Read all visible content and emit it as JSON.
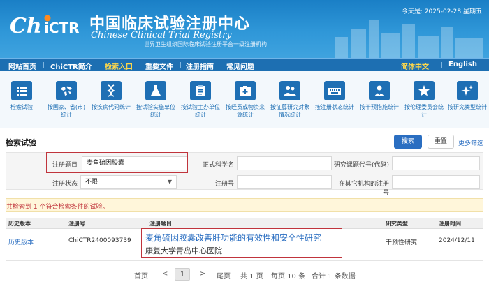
{
  "header": {
    "logo_text": "ChiCTR",
    "title_cn": "中国临床试验注册中心",
    "title_en": "Chinese Clinical Trial Registry",
    "subtitle": "世界卫生组织国际临床试验注册平台一级注册机构",
    "today_label": "今天是: 2025-02-28 星期五"
  },
  "nav": {
    "items": [
      "网站首页",
      "ChiCTR简介",
      "检索入口",
      "重要文件",
      "注册指南",
      "常见问题"
    ],
    "active": "检索入口",
    "lang": [
      "简体中文",
      "English"
    ]
  },
  "iconbar": {
    "items": [
      {
        "label": "检索试验",
        "icon": "list-icon"
      },
      {
        "label": "按国家、省(市)统计",
        "icon": "world-map-icon"
      },
      {
        "label": "按疾病代码统计",
        "icon": "dna-icon"
      },
      {
        "label": "按试验实施单位统计",
        "icon": "flask-icon"
      },
      {
        "label": "按试验主办单位统计",
        "icon": "clipboard-icon"
      },
      {
        "label": "按经费或物资来源统计",
        "icon": "medkit-icon"
      },
      {
        "label": "按征募研究对象情况统计",
        "icon": "people-icon"
      },
      {
        "label": "按注册状态统计",
        "icon": "keyboard-icon"
      },
      {
        "label": "按干预措施统计",
        "icon": "doctor-icon"
      },
      {
        "label": "按伦理委员会统计",
        "icon": "star-icon"
      },
      {
        "label": "按研究类型统计",
        "icon": "sparkle-icon"
      }
    ]
  },
  "search": {
    "section_title": "检索试验",
    "search_button": "搜索",
    "reset_button": "重置",
    "more_filter": "更多筛选",
    "fields": {
      "reg_title_label": "注册题目",
      "reg_title_value": "麦角硫因胶囊",
      "sci_name_label": "正式科学名",
      "sci_name_value": "",
      "code_label": "研究课题代号(代码)",
      "code_value": "",
      "status_label": "注册状态",
      "status_value": "不限",
      "regno_label": "注册号",
      "regno_value": "",
      "other_regno_label": "在其它机构的注册号",
      "other_regno_value": ""
    },
    "result_message": "共检索到 1 个符合检索条件的试验。"
  },
  "table": {
    "headers": [
      "历史版本",
      "注册号",
      "注册题目",
      "研究类型",
      "注册时间"
    ],
    "rows": [
      {
        "history": "历史版本",
        "reg_no": "ChiCTR2400093739",
        "title": "麦角硫因胶囊改善肝功能的有效性和安全性研究",
        "institution": "康复大学青岛中心医院",
        "study_type": "干预性研究",
        "reg_date": "2024/12/11"
      }
    ]
  },
  "pager": {
    "first": "首页",
    "prev": "<",
    "current": "1",
    "next": ">",
    "last": "尾页",
    "total_pages": "共 1 页",
    "per_page": "每页 10 条",
    "total_records": "合计 1 条数据"
  },
  "colors": {
    "header_blue": "#1a7fc6",
    "nav_blue": "#1d6fb2",
    "link_blue": "#2a6ec1",
    "highlight_red": "#c0343c",
    "active_nav_yellow": "#ffd84a"
  }
}
